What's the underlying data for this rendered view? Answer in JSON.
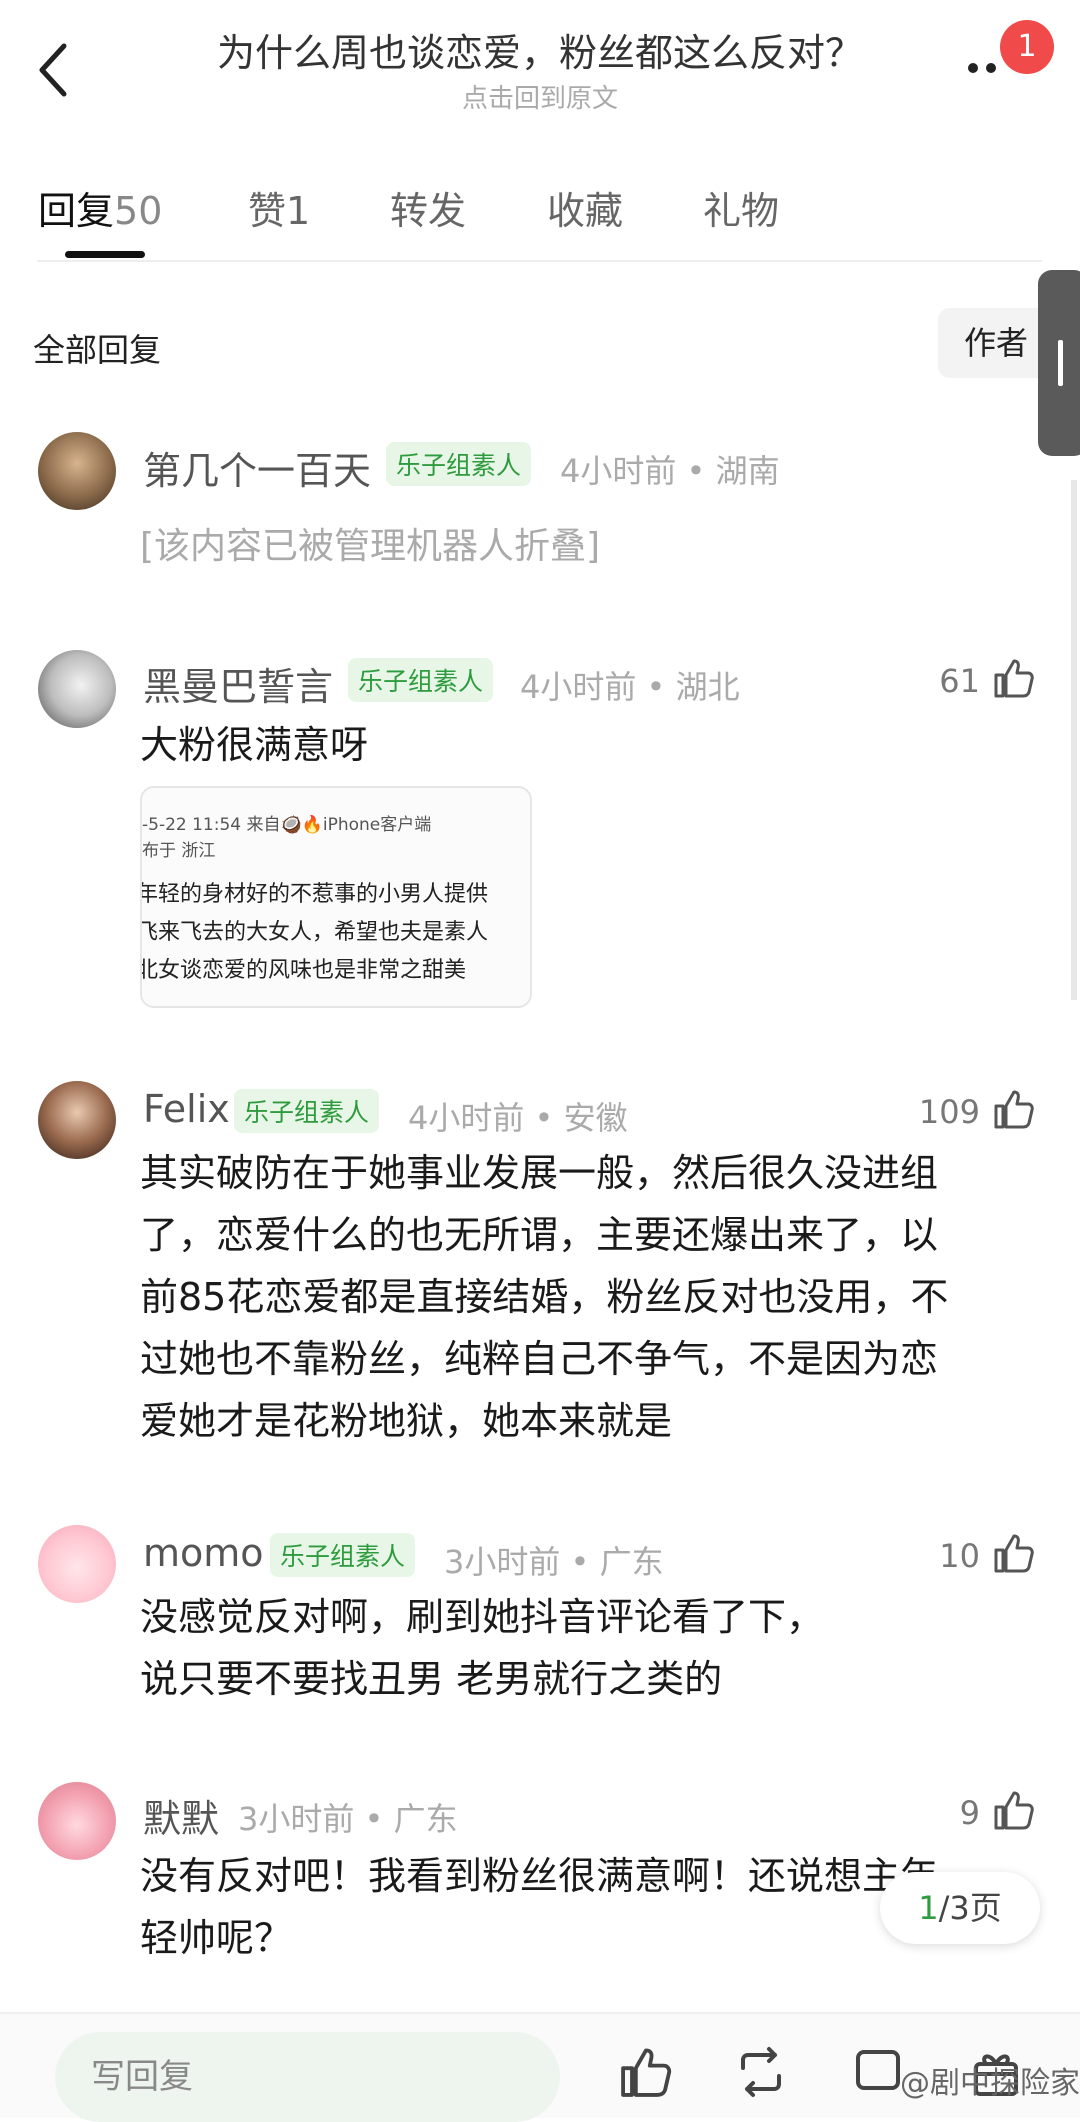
{
  "header": {
    "title": "为什么周也谈恋爱，粉丝都这么反对？",
    "subtitle": "点击回到原文",
    "notification_count": "1"
  },
  "tabs": [
    {
      "label": "回复",
      "count": "50"
    },
    {
      "label": "赞",
      "count": "1"
    },
    {
      "label": "转发",
      "count": ""
    },
    {
      "label": "收藏",
      "count": ""
    },
    {
      "label": "礼物",
      "count": ""
    }
  ],
  "section": {
    "all_replies": "全部回复",
    "author_filter": "作者"
  },
  "comments": [
    {
      "name": "第几个一百天",
      "tag": "乐子组素人",
      "time": "4小时前",
      "location": "湖南",
      "likes": "",
      "folded_text": "[该内容已被管理机器人折叠]"
    },
    {
      "name": "黑曼巴誓言",
      "tag": "乐子组素人",
      "time": "4小时前",
      "location": "湖北",
      "likes": "61",
      "text": "大粉很满意呀",
      "image_lines": {
        "date_source": "-5-22 11:54  来自🥥🔥iPhone客户端",
        "location": "布于 浙江",
        "line1": "年轻的身材好的不惹事的小男人提供",
        "line2": "飞来飞去的大女人，希望也夫是素人",
        "line3": "北女谈恋爱的风味也是非常之甜美"
      }
    },
    {
      "name": "Felix",
      "tag": "乐子组素人",
      "time": "4小时前",
      "location": "安徽",
      "likes": "109",
      "lines": [
        "其实破防在于她事业发展一般，然后很久没进组",
        "了，恋爱什么的也无所谓，主要还爆出来了，以",
        "前85花恋爱都是直接结婚，粉丝反对也没用，不",
        "过她也不靠粉丝，纯粹自己不争气，不是因为恋",
        "爱她才是花粉地狱，她本来就是"
      ]
    },
    {
      "name": "momo",
      "tag": "乐子组素人",
      "time": "3小时前",
      "location": "广东",
      "likes": "10",
      "lines": [
        "没感觉反对啊，刷到她抖音评论看了下，",
        "说只要不要找丑男 老男就行之类的"
      ]
    },
    {
      "name": "默默",
      "tag": "",
      "time": "3小时前",
      "location": "广东",
      "likes": "9",
      "lines": [
        "没有反对吧！我看到粉丝很满意啊！还说想主年",
        "轻帅呢？"
      ]
    }
  ],
  "pager": {
    "current": "1",
    "total": "/3页"
  },
  "bottom_bar": {
    "reply_placeholder": "写回复",
    "watermark": "@剧中探险家"
  },
  "colors": {
    "accent_green": "#2e9b3e",
    "badge_red": "#f04a4a"
  }
}
